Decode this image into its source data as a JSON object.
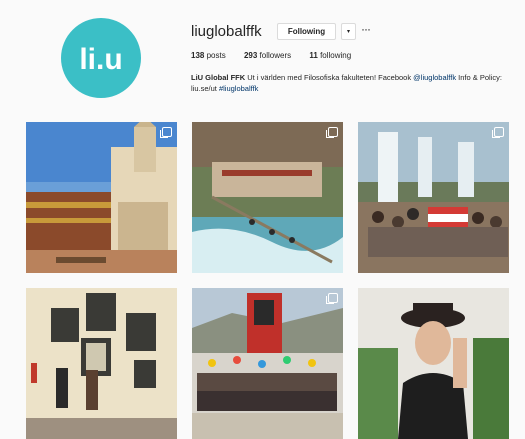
{
  "profile": {
    "username": "liuglobalffk",
    "following_label": "Following",
    "dropdown_glyph": "▾",
    "more_glyph": "···",
    "avatar_logo_text": "li.u",
    "stats": {
      "posts_count": "138",
      "posts_label": "posts",
      "followers_count": "293",
      "followers_label": "followers",
      "following_count": "11",
      "following_label": "following"
    },
    "bio": {
      "name": "LiU Global FFK",
      "text1": " Ut i världen med Filosofiska fakulteten! Facebook ",
      "mention": "@liuglobalffk",
      "text2": " Info & Policy: liu.se/ut ",
      "hashtag": "#liuglobalffk"
    }
  },
  "posts": [
    {
      "scene": "colonial-plaza-church",
      "multi": true
    },
    {
      "scene": "river-suspension-bridge",
      "multi": true
    },
    {
      "scene": "waterfall-group-flag",
      "multi": true
    },
    {
      "scene": "museum-portrait-wall",
      "multi": false
    },
    {
      "scene": "university-group-balloons",
      "multi": true
    },
    {
      "scene": "woman-portrait-hat",
      "multi": false
    }
  ],
  "colors": {
    "avatar_bg": "#3bbfc6",
    "link": "#003569",
    "text": "#262626",
    "border": "#dbdbdb"
  }
}
